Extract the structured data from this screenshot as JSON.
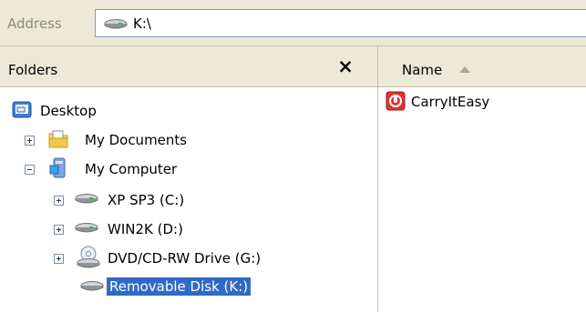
{
  "address_bar": {
    "label": "Address",
    "value": "K:\\",
    "icon": "drive-icon"
  },
  "folders_pane": {
    "title": "Folders",
    "close_label": "×",
    "tree": [
      {
        "label": "Desktop",
        "icon": "desktop-icon",
        "expander": "none"
      },
      {
        "label": "My Documents",
        "icon": "folder-icon",
        "expander": "plus"
      },
      {
        "label": "My Computer",
        "icon": "computer-icon",
        "expander": "minus"
      },
      {
        "label": "XP SP3 (C:)",
        "icon": "drive-icon",
        "expander": "plus"
      },
      {
        "label": "WIN2K (D:)",
        "icon": "drive-icon",
        "expander": "plus"
      },
      {
        "label": "DVD/CD-RW Drive (G:)",
        "icon": "cd-drive-icon",
        "expander": "plus"
      },
      {
        "label": "Removable Disk (K:)",
        "icon": "removable-disk-icon",
        "expander": "none",
        "selected": true
      }
    ]
  },
  "files_pane": {
    "column_name": "Name",
    "files": [
      {
        "label": "CarryItEasy",
        "icon": "app-icon"
      }
    ]
  },
  "colors": {
    "selection": "#316ac5",
    "chrome": "#ece9d8"
  }
}
